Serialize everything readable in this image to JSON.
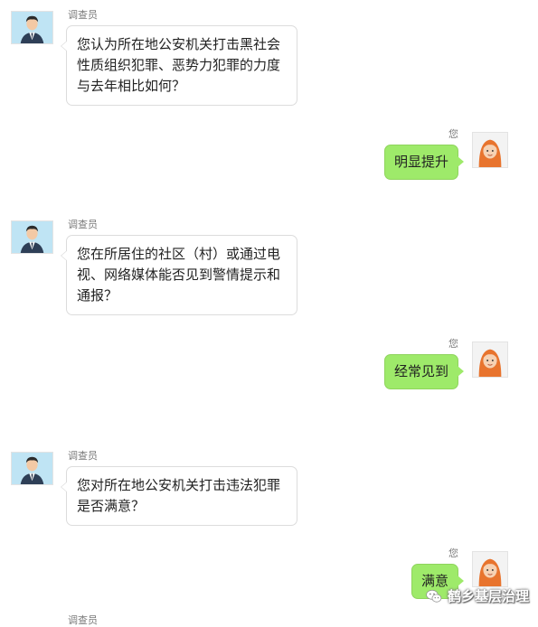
{
  "messages": [
    {
      "side": "left",
      "sender": "调查员",
      "text": "您认为所在地公安机关打击黑社会性质组织犯罪、恶势力犯罪的力度与去年相比如何？"
    },
    {
      "side": "right",
      "sender": "您",
      "text": "明显提升"
    },
    {
      "side": "left",
      "sender": "调查员",
      "text": "您在所居住的社区（村）或通过电视、网络媒体能否见到警情提示和通报？"
    },
    {
      "side": "right",
      "sender": "您",
      "text": "经常见到"
    },
    {
      "side": "left",
      "sender": "调查员",
      "text": "您对所在地公安机关打击违法犯罪是否满意？"
    },
    {
      "side": "right",
      "sender": "您",
      "text": "满意"
    },
    {
      "side": "left",
      "sender": "调查员",
      "text": ""
    }
  ],
  "watermark": {
    "text": "鹤乡基层治理",
    "icon": "wechat-icon"
  },
  "colors": {
    "right_bubble": "#9eea6a",
    "left_bubble": "#ffffff",
    "male_avatar_bg": "#bfe4f4"
  }
}
